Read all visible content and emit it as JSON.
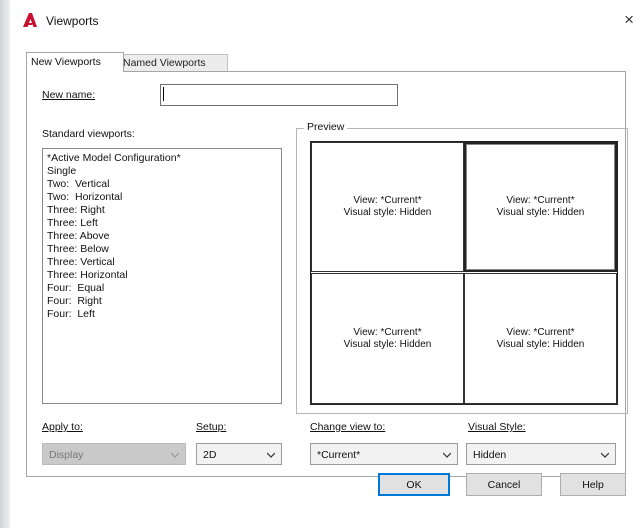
{
  "window": {
    "title": "Viewports",
    "close_glyph": "×",
    "app_icon": "autocad-a-icon",
    "app_icon_color": "#c8102e"
  },
  "tabs": [
    {
      "label": "New Viewports",
      "active": true
    },
    {
      "label": "Named Viewports",
      "active": false
    }
  ],
  "new_name": {
    "label": "New name:",
    "value": ""
  },
  "standard_viewports": {
    "label": "Standard viewports:",
    "items": [
      "*Active Model Configuration*",
      "Single",
      "Two:  Vertical",
      "Two:  Horizontal",
      "Three: Right",
      "Three: Left",
      "Three: Above",
      "Three: Below",
      "Three: Vertical",
      "Three: Horizontal",
      "Four:  Equal",
      "Four:  Right",
      "Four:  Left"
    ]
  },
  "preview": {
    "label": "Preview",
    "viewports": [
      {
        "view": "View: *Current*",
        "style": "Visual style: Hidden",
        "active": false
      },
      {
        "view": "View: *Current*",
        "style": "Visual style: Hidden",
        "active": true
      },
      {
        "view": "View: *Current*",
        "style": "Visual style: Hidden",
        "active": false
      },
      {
        "view": "View: *Current*",
        "style": "Visual style: Hidden",
        "active": false
      }
    ]
  },
  "apply_to": {
    "label": "Apply to:",
    "value": "Display",
    "disabled": true
  },
  "setup": {
    "label": "Setup:",
    "value": "2D"
  },
  "change_view_to": {
    "label": "Change view to:",
    "value": "*Current*"
  },
  "visual_style": {
    "label": "Visual Style:",
    "value": "Hidden"
  },
  "buttons": {
    "ok": "OK",
    "cancel": "Cancel",
    "help": "Help"
  }
}
